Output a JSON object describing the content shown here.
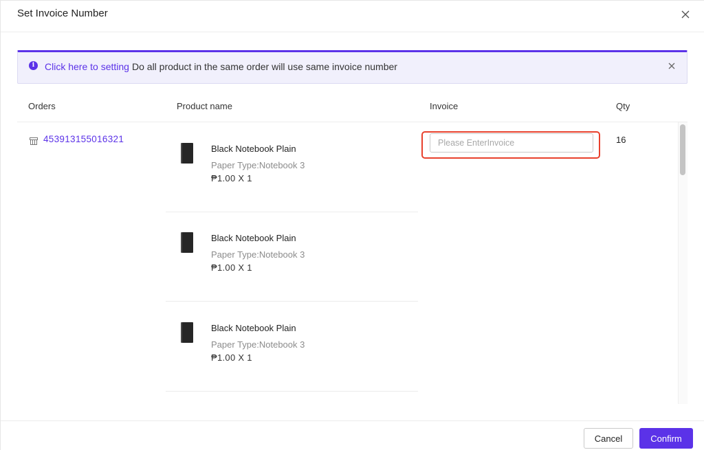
{
  "modal": {
    "title": "Set Invoice Number",
    "close_icon": "close-icon"
  },
  "notice": {
    "icon": "info-icon",
    "link_text": "Click here to setting",
    "text": "Do all product in the same order will use same invoice number",
    "close_icon": "close-icon",
    "accent_color": "#5b32e8"
  },
  "table": {
    "columns": [
      "Orders",
      "Product name",
      "Invoice",
      "Qty"
    ],
    "order": {
      "icon": "store-icon",
      "order_number": "453913155016321",
      "qty": "16",
      "invoice_value": "",
      "invoice_placeholder": "Please EnterInvoice"
    },
    "products": [
      {
        "name": "Black Notebook Plain",
        "variant": "Paper Type:Notebook 3",
        "price": "₱1.00 X 1"
      },
      {
        "name": "Black Notebook Plain",
        "variant": "Paper Type:Notebook 3",
        "price": "₱1.00 X 1"
      },
      {
        "name": "Black Notebook Plain",
        "variant": "Paper Type:Notebook 3",
        "price": "₱1.00 X 1"
      }
    ]
  },
  "footer": {
    "cancel_label": "Cancel",
    "confirm_label": "Confirm"
  },
  "colors": {
    "primary": "#5b32e8",
    "highlight": "#e8402c"
  }
}
